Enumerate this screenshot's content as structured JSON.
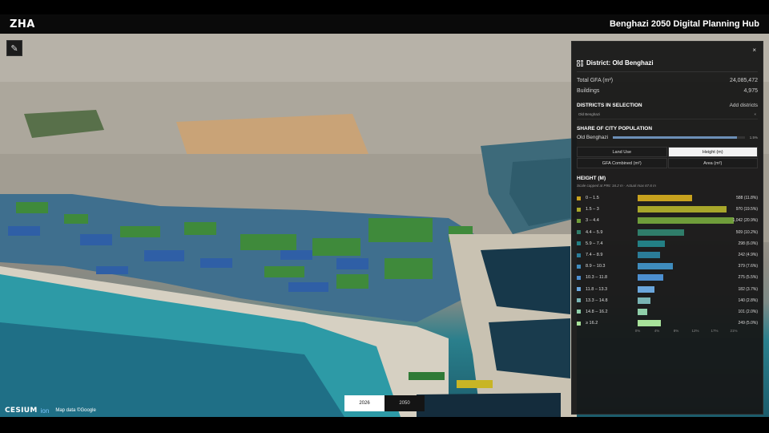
{
  "header": {
    "brand": "ZHA",
    "title": "Benghazi 2050 Digital Planning Hub"
  },
  "toolbar": {
    "tool_icon": "draw-icon"
  },
  "footer": {
    "cesium_logo": "CESIUM",
    "cesium_ion": "ion",
    "attribution": "Map data ©Google"
  },
  "year_toggle": {
    "options": [
      "2026",
      "2050"
    ],
    "selected": "2026"
  },
  "panel": {
    "close": "×",
    "district_title": "District: Old Benghazi",
    "stats": [
      {
        "label": "Total GFA (m²)",
        "value": "24,085,472"
      },
      {
        "label": "Buildings",
        "value": "4,975"
      }
    ],
    "districts_label": "DISTRICTS IN SELECTION",
    "add_district": "Add districts",
    "selected_district": "Old Benghazi",
    "remove": "×",
    "population_label": "SHARE OF CITY POPULATION",
    "population_district": "Old Benghazi",
    "population_value": "1.5%",
    "population_fraction": 0.94,
    "tabs": [
      "Land Use",
      "Height (m)",
      "GFA Combined (m²)",
      "Area (m²)"
    ],
    "active_tab": "Height (m)",
    "height_title": "HEIGHT (M)",
    "height_note": "Scale capped at P95: 16.2 m · Actual max 67.6 m",
    "chart_data": {
      "type": "bar",
      "categories": [
        "0 – 1.5",
        "1.5 – 3",
        "3 – 4.4",
        "4.4 – 5.9",
        "5.9 – 7.4",
        "7.4 – 8.9",
        "8.9 – 10.3",
        "10.3 – 11.8",
        "11.8 – 13.3",
        "13.3 – 14.8",
        "14.8 – 16.2",
        "≥ 16.2"
      ],
      "values": [
        588,
        970,
        1042,
        509,
        298,
        242,
        379,
        275,
        182,
        140,
        101,
        249
      ],
      "labels": [
        "588 (11.8%)",
        "970 (19.5%)",
        "1,042 (20.9%)",
        "509 (10.2%)",
        "298 (6.0%)",
        "242 (4.9%)",
        "379 (7.6%)",
        "275 (5.5%)",
        "182 (3.7%)",
        "140 (2.8%)",
        "101 (2.0%)",
        "249 (5.0%)"
      ],
      "colors": [
        "#c8a21e",
        "#a8a72a",
        "#6f9d3a",
        "#2f7d6a",
        "#237f84",
        "#2b7c98",
        "#3f8cbd",
        "#4d8fd0",
        "#6aa6dc",
        "#79b4b4",
        "#8fcfa9",
        "#a8e29a"
      ],
      "xticks": [
        "0%",
        "4%",
        "8%",
        "12%",
        "17%",
        "21%"
      ],
      "xlim": [
        0,
        21
      ]
    }
  }
}
